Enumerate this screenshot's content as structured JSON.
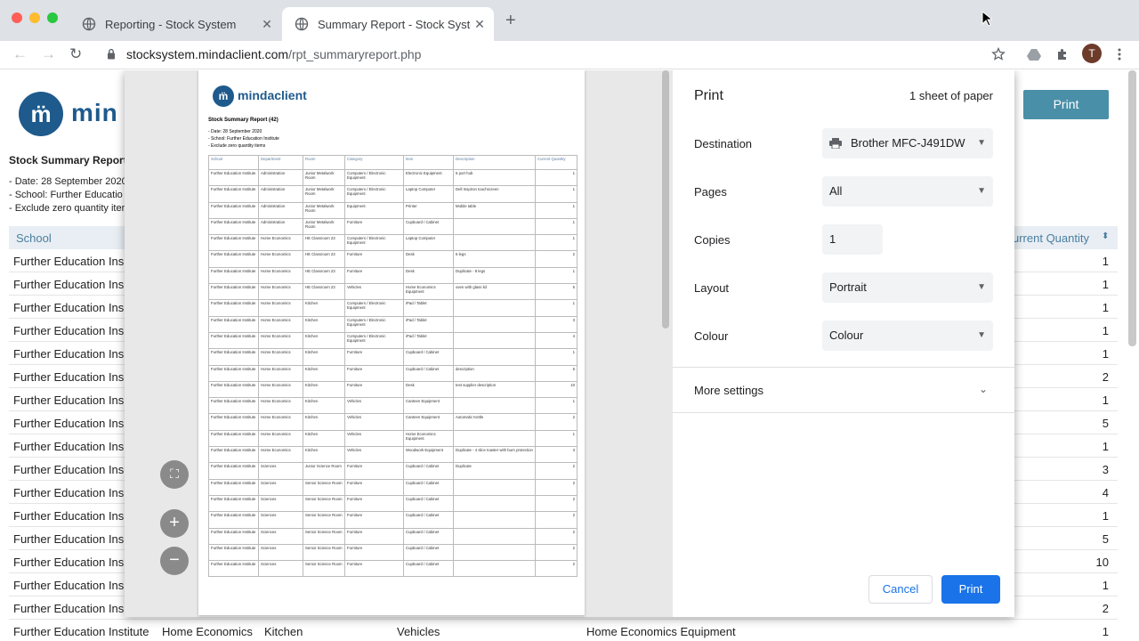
{
  "browser": {
    "tabs": [
      {
        "title": "Reporting - Stock System",
        "active": false
      },
      {
        "title": "Summary Report - Stock System",
        "active": true
      }
    ],
    "url_host": "stocksystem.mindaclient.com",
    "url_path": "/rpt_summaryreport.php",
    "avatar_letter": "T"
  },
  "page": {
    "logo_text": "min",
    "report_title": "Stock Summary Report",
    "meta": [
      "- Date: 28 September 2020",
      "- School: Further Educatio",
      "- Exclude zero quantity iter"
    ],
    "print_label": "Print",
    "col_school": "School",
    "col_quantity": "urrent Quantity",
    "row_school": "Further Education Ins",
    "quantities": [
      "1",
      "1",
      "1",
      "1",
      "1",
      "2",
      "1",
      "5",
      "1",
      "3",
      "4",
      "1",
      "5",
      "10",
      "1",
      "2"
    ],
    "last_row": {
      "school": "Further Education Institute",
      "department": "Home Economics",
      "room": "Kitchen",
      "category": "Vehicles",
      "item": "Home Economics Equipment",
      "quantity": "1"
    }
  },
  "preview": {
    "logo_text": "mindaclient",
    "title": "Stock Summary Report (42)",
    "meta": [
      "- Date: 28 September 2020",
      "- School: Further Education Institute",
      "- Exclude zero quantity items"
    ],
    "headers": [
      "School",
      "Department",
      "Room",
      "Category",
      "Item",
      "Description",
      "Current Quantity"
    ],
    "rows": [
      [
        "Further Education Institute",
        "Administration",
        "Junior Metalwork Room",
        "Computers / Electronic Equipment",
        "Electronic Equipment",
        "5 port hub",
        "1"
      ],
      [
        "Further Education Institute",
        "Administration",
        "Junior Metalwork Room",
        "Computers / Electronic Equipment",
        "Laptop Computer",
        "Dell Inspiron touchscreen",
        "1"
      ],
      [
        "Further Education Institute",
        "Administration",
        "Junior Metalwork Room",
        "Equipment",
        "Printer",
        "Mobile table",
        "1"
      ],
      [
        "Further Education Institute",
        "Administration",
        "Junior Metalwork Room",
        "Furniture",
        "Cupboard / Cabinet",
        "",
        "1"
      ],
      [
        "Further Education Institute",
        "Home Economics",
        "HE Classroom 23",
        "Computers / Electronic Equipment",
        "Laptop Computer",
        "",
        "1"
      ],
      [
        "Further Education Institute",
        "Home Economics",
        "HE Classroom 23",
        "Furniture",
        "Desk",
        "6 legs",
        "2"
      ],
      [
        "Further Education Institute",
        "Home Economics",
        "HE Classroom 23",
        "Furniture",
        "Desk",
        "Duplicate - 8 legs",
        "1"
      ],
      [
        "Further Education Institute",
        "Home Economics",
        "HE Classroom 23",
        "Vehicles",
        "Home Economics Equipment",
        "oven with glass lid",
        "5"
      ],
      [
        "Further Education Institute",
        "Home Economics",
        "Kitchen",
        "Computers / Electronic Equipment",
        "iPad / Tablet",
        "",
        "1"
      ],
      [
        "Further Education Institute",
        "Home Economics",
        "Kitchen",
        "Computers / Electronic Equipment",
        "iPad / Tablet",
        "",
        "3"
      ],
      [
        "Further Education Institute",
        "Home Economics",
        "Kitchen",
        "Computers / Electronic Equipment",
        "iPad / Tablet",
        "",
        "4"
      ],
      [
        "Further Education Institute",
        "Home Economics",
        "Kitchen",
        "Furniture",
        "Cupboard / Cabinet",
        "",
        "1"
      ],
      [
        "Further Education Institute",
        "Home Economics",
        "Kitchen",
        "Furniture",
        "Cupboard / Cabinet",
        "description",
        "5"
      ],
      [
        "Further Education Institute",
        "Home Economics",
        "Kitchen",
        "Furniture",
        "Desk",
        "test supplier description",
        "10"
      ],
      [
        "Further Education Institute",
        "Home Economics",
        "Kitchen",
        "Vehicles",
        "Canteen Equipment",
        "",
        "1"
      ],
      [
        "Further Education Institute",
        "Home Economics",
        "Kitchen",
        "Vehicles",
        "Canteen Equipment",
        "Automatic Kettle",
        "2"
      ],
      [
        "Further Education Institute",
        "Home Economics",
        "Kitchen",
        "Vehicles",
        "Home Economics Equipment",
        "",
        "1"
      ],
      [
        "Further Education Institute",
        "Home Economics",
        "Kitchen",
        "Vehicles",
        "Woodwork Equipment",
        "Duplicate - 4 slice toaster with burn protection",
        "3"
      ],
      [
        "Further Education Institute",
        "Sciences",
        "Junior Science Room",
        "Furniture",
        "Cupboard / Cabinet",
        "Duplicate",
        "2"
      ],
      [
        "Further Education Institute",
        "Sciences",
        "Senior Science Room",
        "Furniture",
        "Cupboard / Cabinet",
        "",
        "2"
      ],
      [
        "Further Education Institute",
        "Sciences",
        "Senior Science Room",
        "Furniture",
        "Cupboard / Cabinet",
        "",
        "2"
      ],
      [
        "Further Education Institute",
        "Sciences",
        "Senior Science Room",
        "Furniture",
        "Cupboard / Cabinet",
        "",
        "2"
      ],
      [
        "Further Education Institute",
        "Sciences",
        "Senior Science Room",
        "Furniture",
        "Cupboard / Cabinet",
        "",
        "2"
      ],
      [
        "Further Education Institute",
        "Sciences",
        "Senior Science Room",
        "Furniture",
        "Cupboard / Cabinet",
        "",
        "2"
      ],
      [
        "Further Education Institute",
        "Sciences",
        "Senior Science Room",
        "Furniture",
        "Cupboard / Cabinet",
        "",
        "2"
      ]
    ]
  },
  "dialog": {
    "title": "Print",
    "sheets": "1 sheet of paper",
    "destination_label": "Destination",
    "destination_value": "Brother MFC-J491DW",
    "pages_label": "Pages",
    "pages_value": "All",
    "copies_label": "Copies",
    "copies_value": "1",
    "layout_label": "Layout",
    "layout_value": "Portrait",
    "colour_label": "Colour",
    "colour_value": "Colour",
    "more_settings": "More settings",
    "cancel": "Cancel",
    "print": "Print"
  }
}
